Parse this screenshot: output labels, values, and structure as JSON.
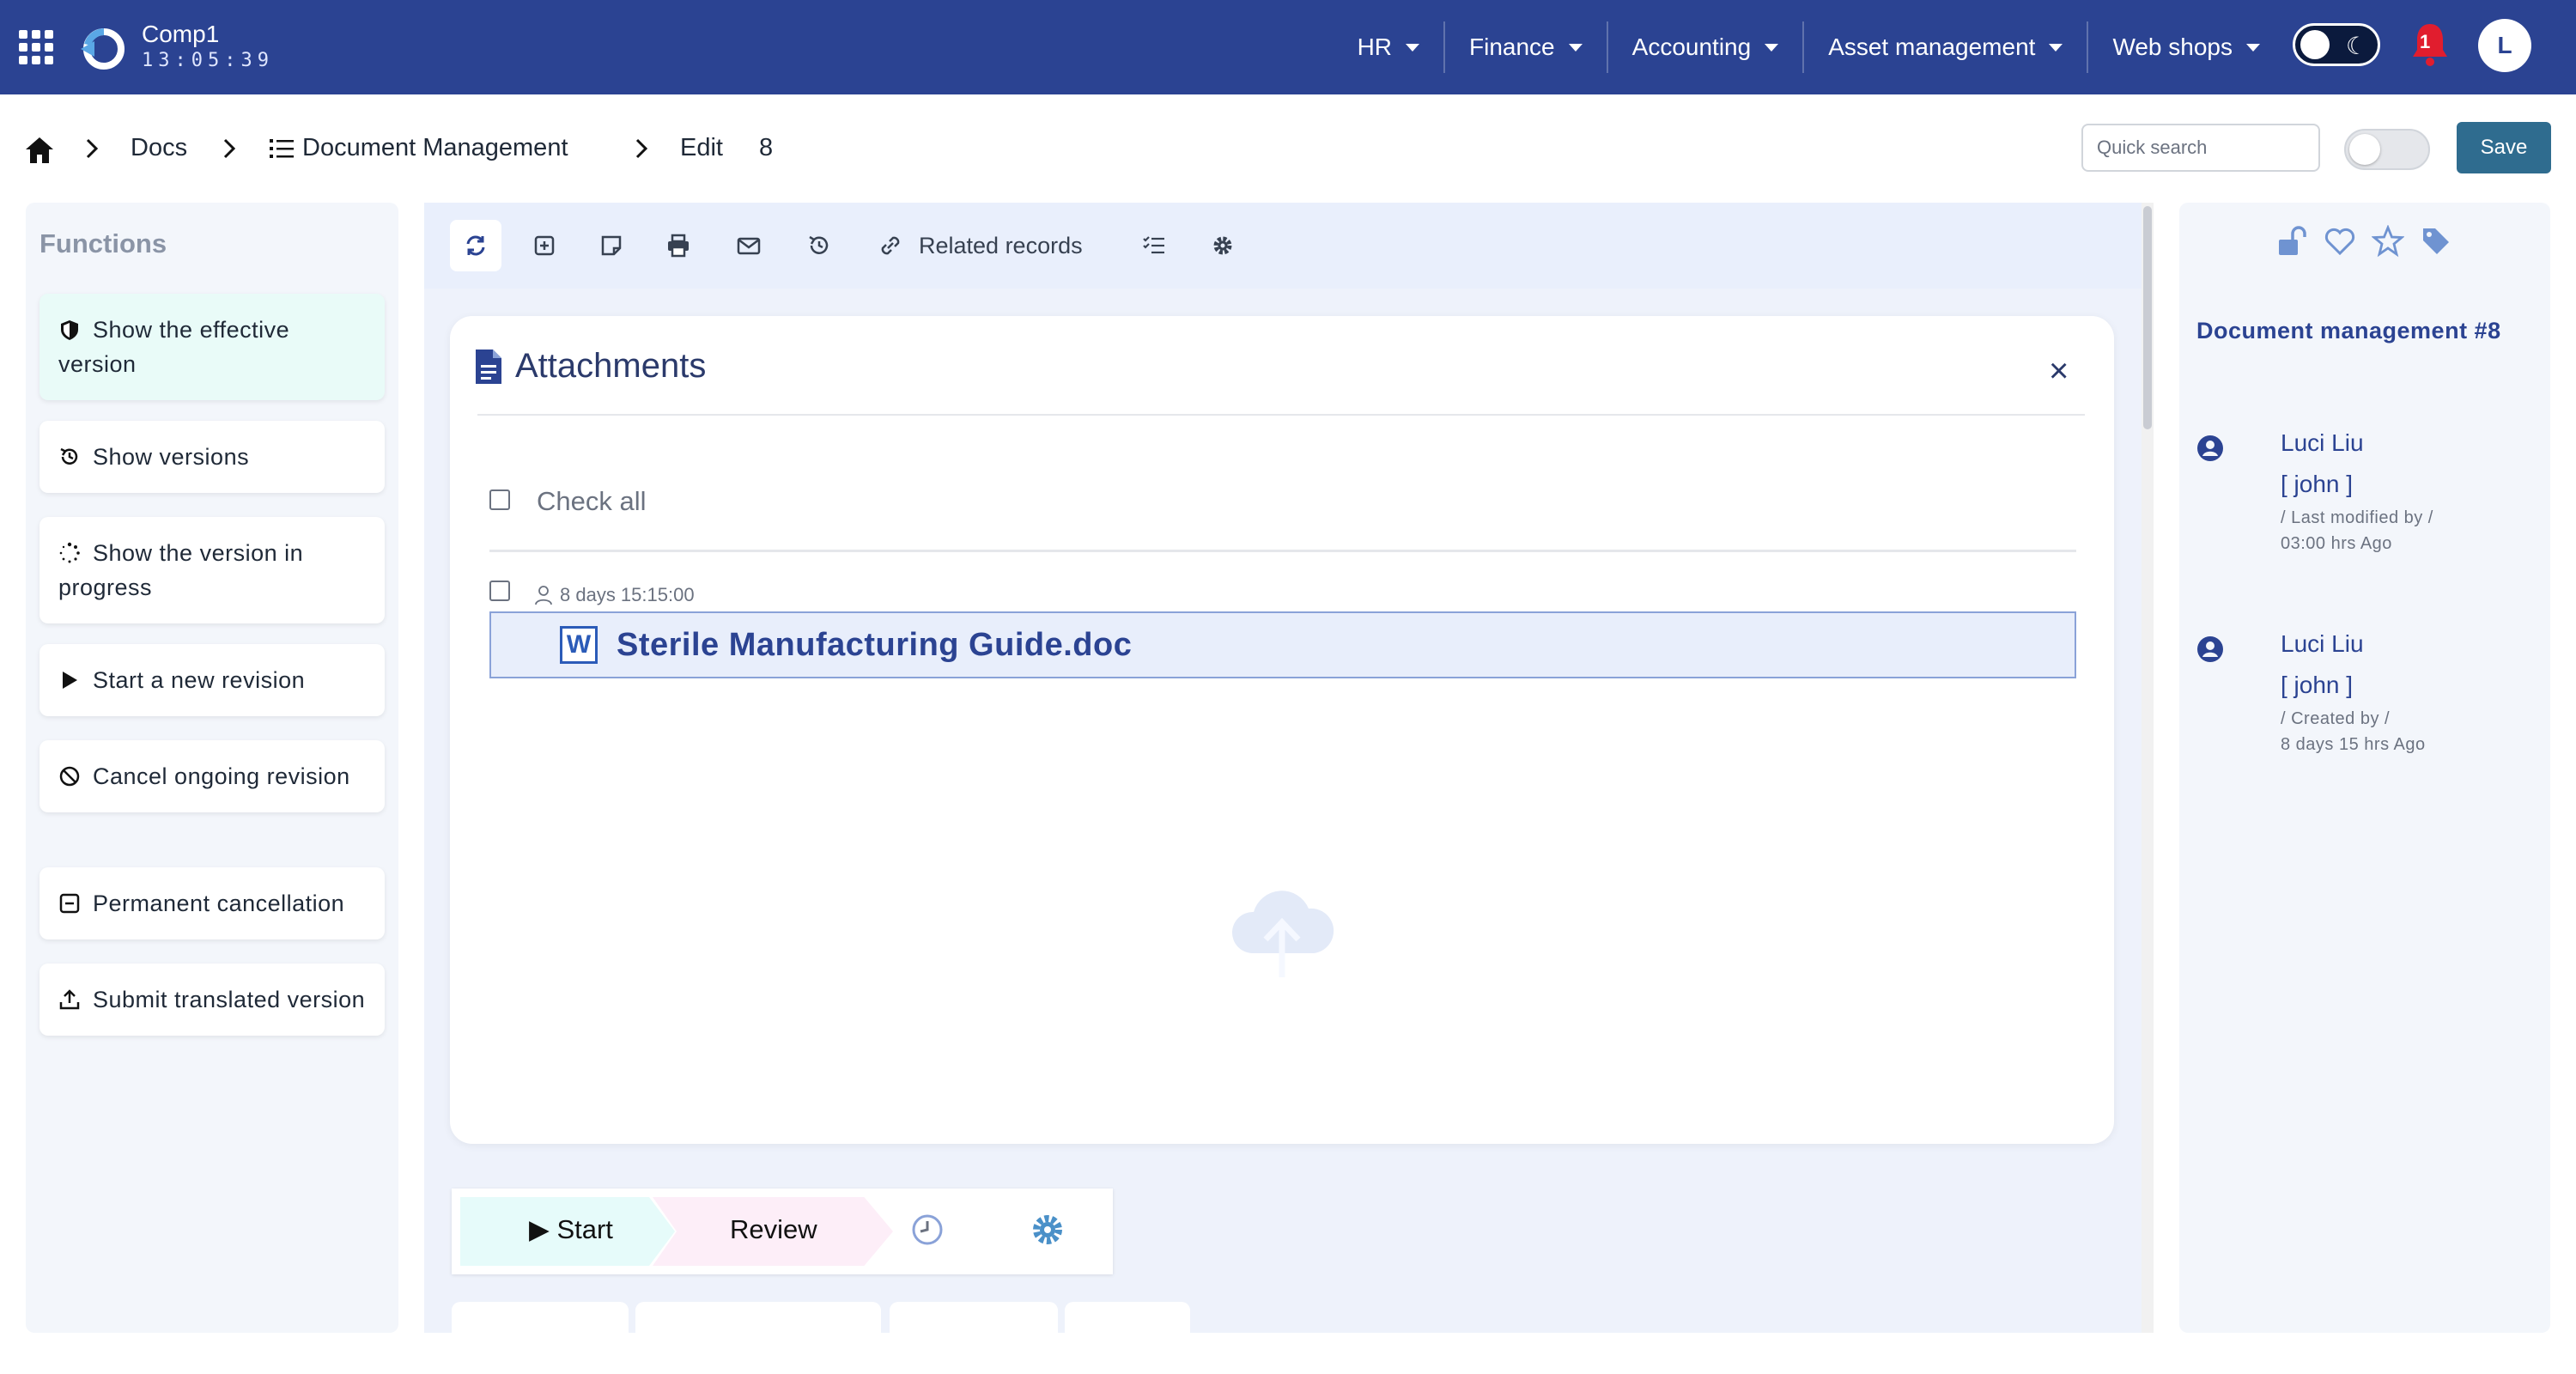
{
  "topbar": {
    "brand_name": "Comp1",
    "clock": "13:05:39",
    "menu": [
      "HR",
      "Finance",
      "Accounting",
      "Asset management",
      "Web shops"
    ],
    "notification_count": "1",
    "avatar_initial": "L"
  },
  "breadcrumb": {
    "docs": "Docs",
    "module": "Document Management",
    "edit": "Edit",
    "record_id": "8"
  },
  "header_actions": {
    "quick_search_placeholder": "Quick search",
    "save_label": "Save"
  },
  "functions": {
    "title": "Functions",
    "items": [
      {
        "label": "Show the effective version",
        "icon": "shield-icon"
      },
      {
        "label": "Show versions",
        "icon": "history-icon"
      },
      {
        "label": "Show the version in progress",
        "icon": "spinner-icon"
      },
      {
        "label": "Start a new revision",
        "icon": "play-icon"
      },
      {
        "label": "Cancel ongoing revision",
        "icon": "ban-icon"
      },
      {
        "label": "Permanent cancellation",
        "icon": "minus-square-icon"
      },
      {
        "label": "Submit translated version",
        "icon": "upload-icon"
      }
    ]
  },
  "toolbar": {
    "related_records": "Related records"
  },
  "attachments": {
    "title": "Attachments",
    "close": "×",
    "check_all": "Check all",
    "files": [
      {
        "meta": "8 days 15:15:00",
        "name": "Sterile Manufacturing Guide.doc",
        "type_badge": "W"
      }
    ]
  },
  "workflow": {
    "start": "▶ Start",
    "review": "Review"
  },
  "record_panel": {
    "title": "Document management #8",
    "entries": [
      {
        "name": "Luci Liu",
        "user": "[ john ]",
        "meta1": "/ Last modified by /",
        "meta2": "03:00 hrs Ago"
      },
      {
        "name": "Luci Liu",
        "user": "[ john ]",
        "meta1": "/ Created by /",
        "meta2": "8 days 15 hrs Ago"
      }
    ]
  },
  "colors": {
    "navbar": "#2b4392",
    "save_button": "#2f6c8f",
    "accent_text": "#2b4392",
    "active_function": "#e9fbf8"
  }
}
